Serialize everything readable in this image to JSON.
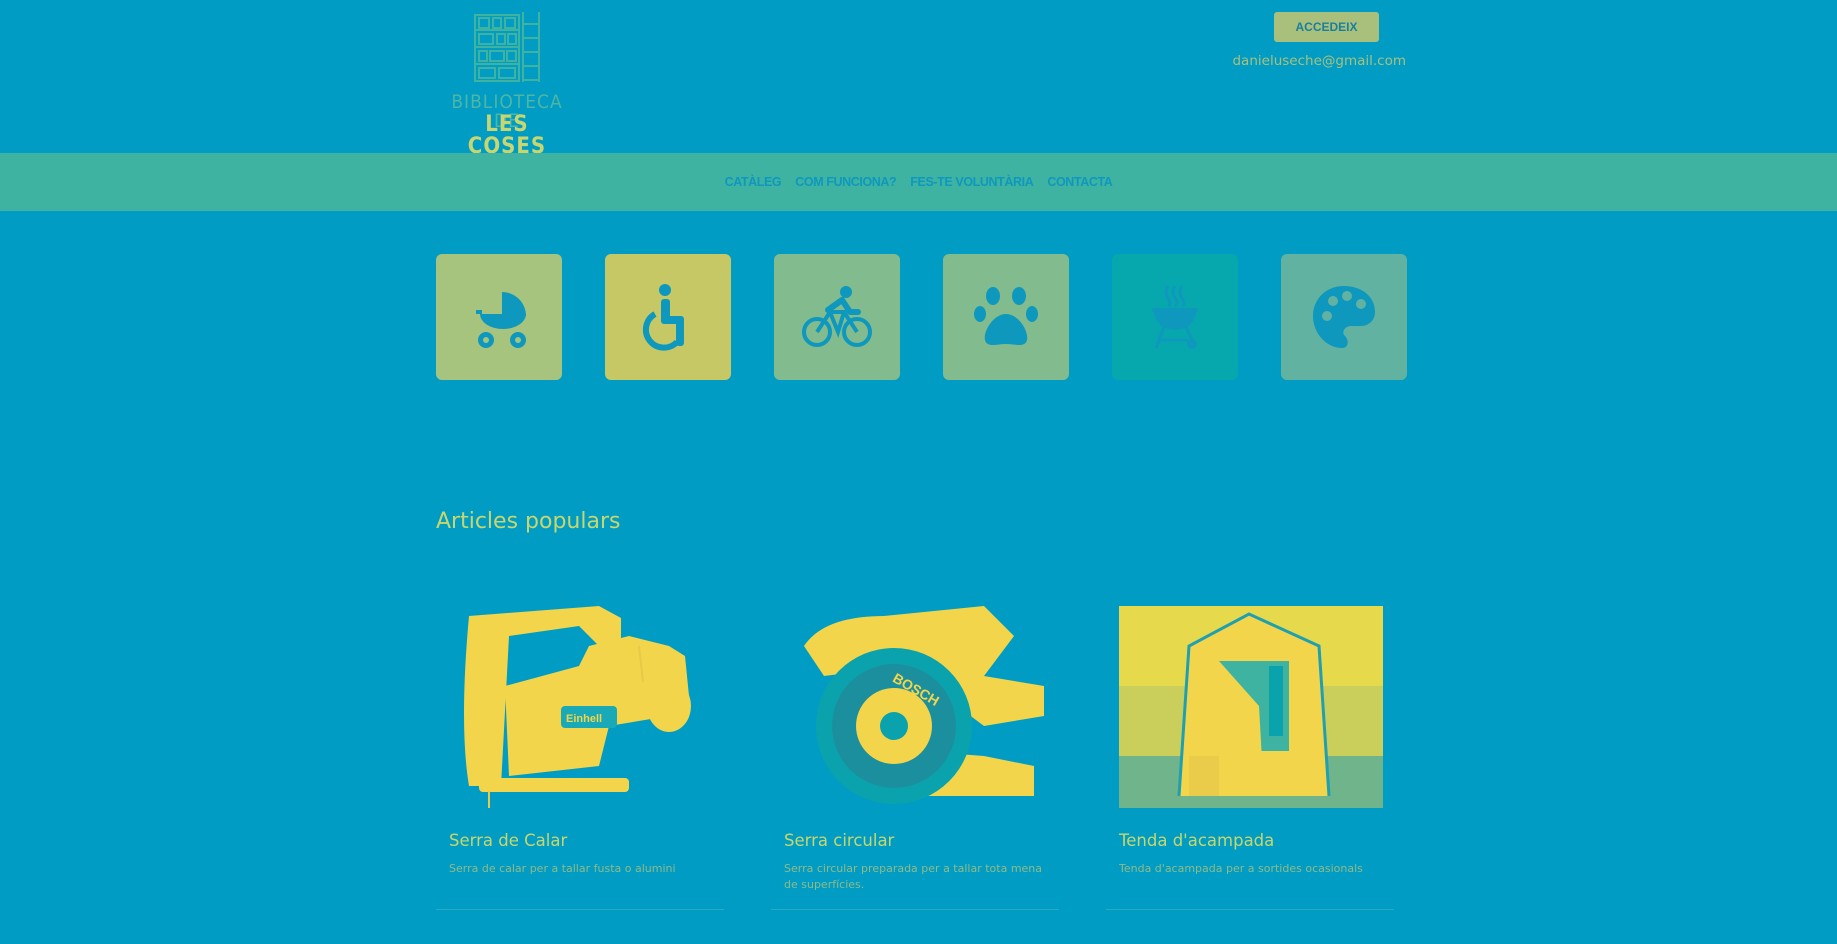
{
  "header": {
    "logo": {
      "line1": "BIBLIOTECA DE",
      "line2": "LES COSES"
    },
    "login_label": "ACCEDEIX",
    "user_email": "danieluseche@gmail.com"
  },
  "nav": {
    "items": [
      {
        "label": "CATÀLEG"
      },
      {
        "label": "COM FUNCIONA?"
      },
      {
        "label": "FES-TE VOLUNTÀRIA"
      },
      {
        "label": "CONTACTA"
      }
    ]
  },
  "categories": [
    {
      "icon": "baby-carriage-icon",
      "color": "#a6c47e"
    },
    {
      "icon": "wheelchair-icon",
      "color": "#c6c865"
    },
    {
      "icon": "bicycle-icon",
      "color": "#82bc8e"
    },
    {
      "icon": "paw-icon",
      "color": "#82bc8e"
    },
    {
      "icon": "grill-icon",
      "color": "#06a8ad"
    },
    {
      "icon": "palette-icon",
      "color": "#62b2a2"
    }
  ],
  "popular": {
    "title": "Articles populars",
    "products": [
      {
        "name": "Serra de Calar",
        "description": "Serra de calar per a tallar fusta o alumini",
        "image": "jigsaw-image"
      },
      {
        "name": "Serra circular",
        "description": "Serra circular preparada per a tallar tota mena de superfícies.",
        "image": "circular-saw-image"
      },
      {
        "name": "Tenda d'acampada",
        "description": "Tenda d'acampada per a sortides ocasionals",
        "image": "tent-image"
      }
    ]
  },
  "colors": {
    "background": "#009cc4",
    "navbar": "#3fb3a1",
    "accent_yellow": "#c8d66d",
    "button": "#a9c07d"
  }
}
